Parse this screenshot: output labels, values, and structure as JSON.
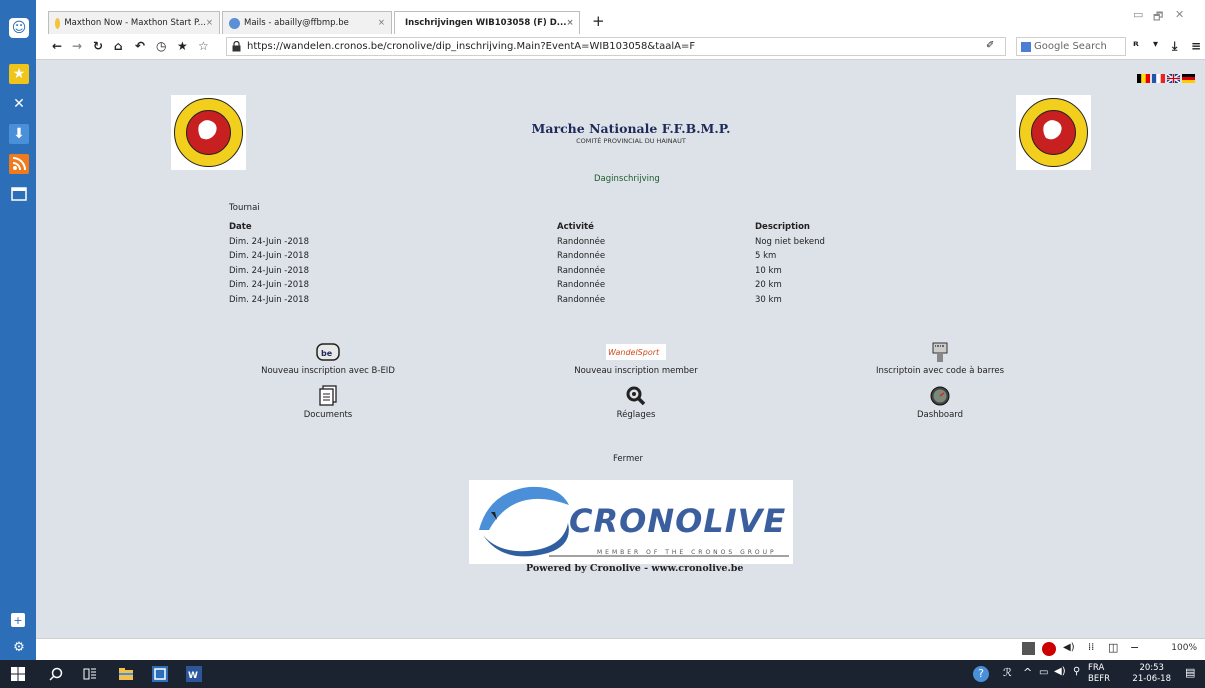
{
  "browser": {
    "tabs": [
      {
        "label": "Maxthon Now - Maxthon Start P..."
      },
      {
        "label": "Mails - abailly@ffbmp.be"
      },
      {
        "label": "Inschrijvingen WIB103058 (F) D..."
      }
    ],
    "url": "https://wandelen.cronos.be/cronolive/dip_inschrijving.Main?EventA=WIB103058&taalA=F",
    "search_placeholder": "Google Search",
    "zoom": "100%"
  },
  "page": {
    "title": "Marche Nationale F.F.B.M.P.",
    "subtitle": "COMITÉ PROVINCIAL DU HAINAUT",
    "mode": "Daginschrijving",
    "city": "Tournai",
    "headers": {
      "date": "Date",
      "activity": "Activité",
      "description": "Description"
    },
    "rows": [
      {
        "date": "Dim. 24-Juin -2018",
        "activity": "Randonnée",
        "description": "Nog niet bekend"
      },
      {
        "date": "Dim. 24-Juin -2018",
        "activity": "Randonnée",
        "description": "5 km"
      },
      {
        "date": "Dim. 24-Juin -2018",
        "activity": "Randonnée",
        "description": "10 km"
      },
      {
        "date": "Dim. 24-Juin -2018",
        "activity": "Randonnée",
        "description": "20 km"
      },
      {
        "date": "Dim. 24-Juin -2018",
        "activity": "Randonnée",
        "description": "30 km"
      }
    ],
    "actions": {
      "beid": "Nouveau inscription avec B-EID",
      "member": "Nouveau inscription member",
      "barcode": "Inscriptoin avec code à barres",
      "documents": "Documents",
      "settings": "Réglages",
      "dashboard": "Dashboard"
    },
    "close": "Fermer",
    "footer_logo": "CRONOLIVE",
    "footer_logo_sub": "MEMBER OF THE CRONOS GROUP",
    "powered_by": "Powered by Cronolive - www.cronolive.be"
  },
  "taskbar": {
    "lang1": "FRA",
    "lang2": "BEFR",
    "time": "20:53",
    "date": "21-06-18"
  }
}
